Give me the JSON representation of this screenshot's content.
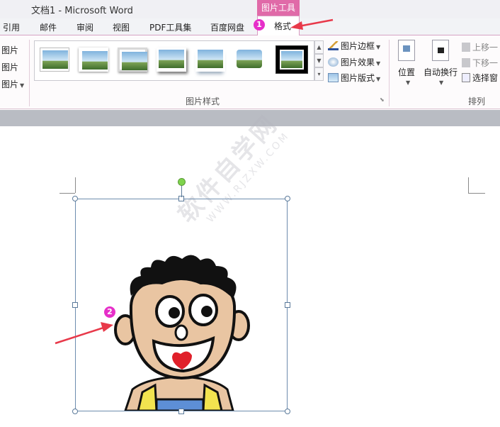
{
  "window": {
    "title": "文档1 - Microsoft Word"
  },
  "context_tab_group": "图片工具",
  "tabs": [
    "引用",
    "邮件",
    "审阅",
    "视图",
    "PDF工具集",
    "百度网盘"
  ],
  "active_tab": "格式",
  "left_group": {
    "items": [
      "图片",
      "图片",
      "图片"
    ]
  },
  "picture_styles": {
    "label": "图片样式",
    "commands": {
      "border": "图片边框",
      "effects": "图片效果",
      "layout": "图片版式"
    }
  },
  "arrange": {
    "label": "排列",
    "position": "位置",
    "wrap": "自动换行",
    "bring_forward": "上移一",
    "send_backward": "下移一",
    "selection_pane": "选择窗"
  },
  "annotations": {
    "badge1": "1",
    "badge2": "2"
  },
  "watermark": {
    "main": "软件自学网",
    "url": "WWW.RJZXW.COM"
  },
  "colors": {
    "context_tab": "#e06aa8",
    "badge": "#e62fc9",
    "arrow": "#e8394a"
  }
}
